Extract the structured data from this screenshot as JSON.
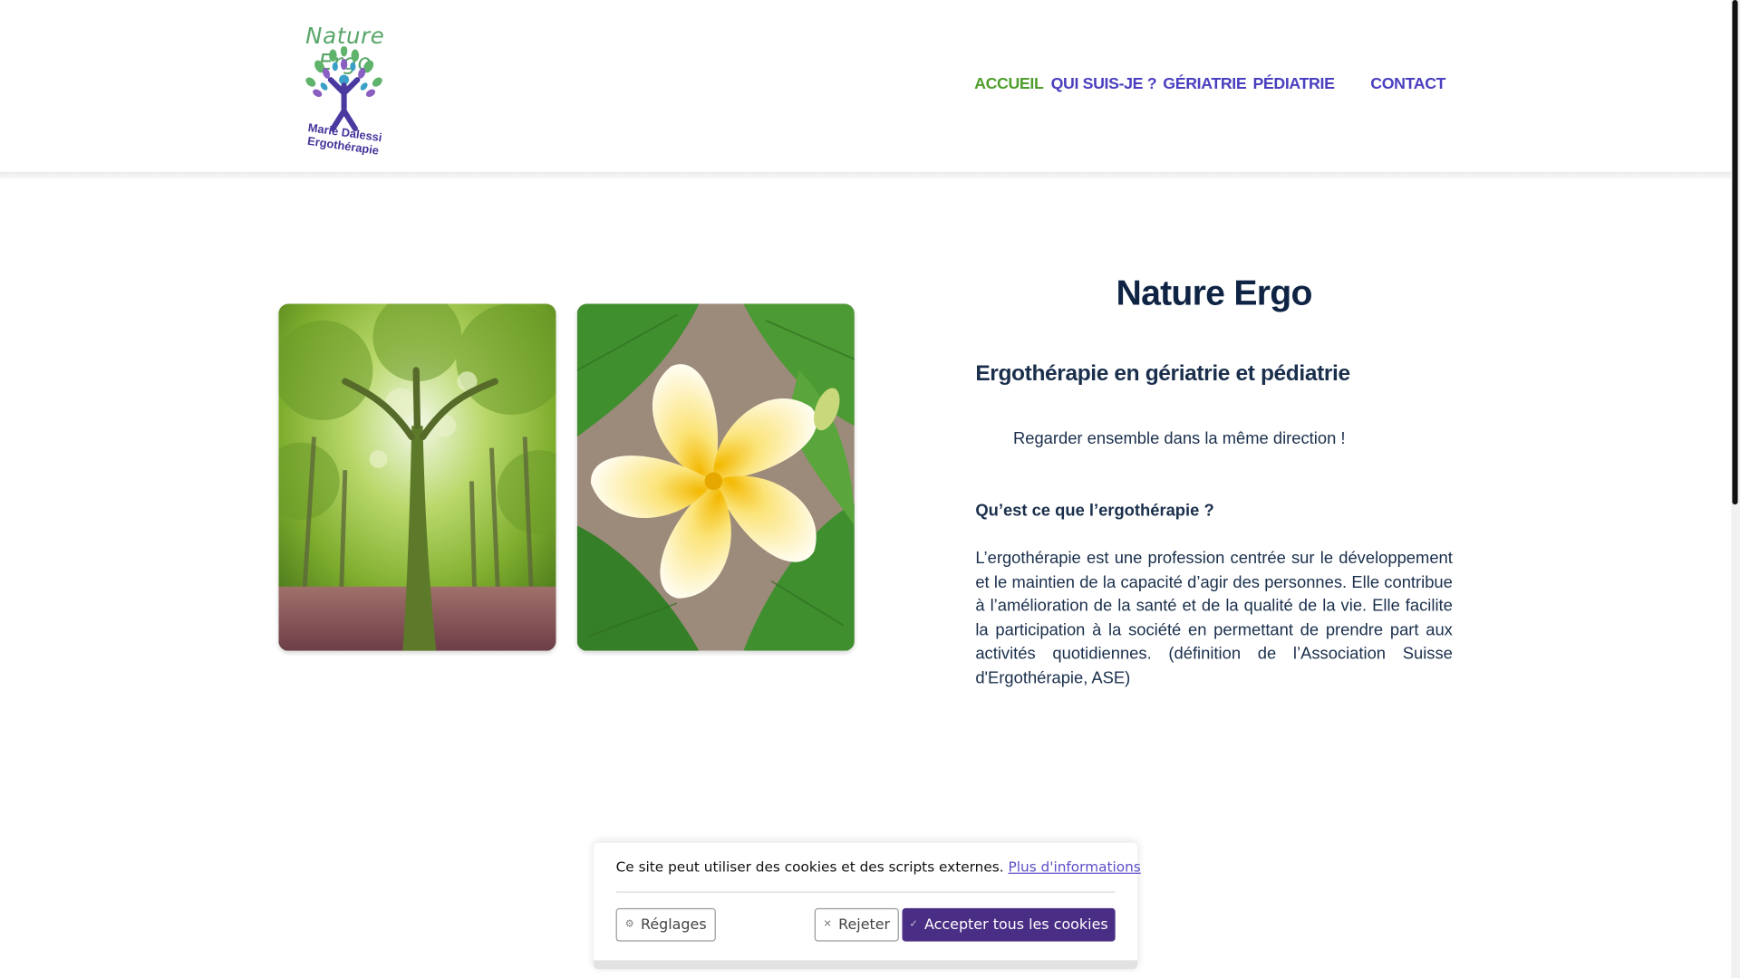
{
  "logo": {
    "title": "Nature Ergo",
    "subtitle": "Marie Dalessi Ergothérapie"
  },
  "nav": {
    "items": [
      {
        "label": "ACCUEIL",
        "active": true
      },
      {
        "label": "QUI SUIS-JE ?",
        "active": false
      },
      {
        "label": "GÉRIATRIE",
        "active": false
      },
      {
        "label": "PÉDIATRIE",
        "active": false
      },
      {
        "label": "CONTACT",
        "active": false
      }
    ]
  },
  "main": {
    "title": "Nature Ergo",
    "subtitle": "Ergothérapie en gériatrie et pédiatrie",
    "tagline": "Regarder ensemble dans la même direction !",
    "question": "Qu’est ce que l’ergothérapie ?",
    "paragraph": "L’ergothérapie est une profession centrée sur le développement et le maintien de la capacité d’agir des personnes. Elle contribue à l’amélioration de la santé et de la qualité de la vie. Elle facilite la participation à la société en permettant de prendre part aux activités quotidiennes. (définition de l’Association Suisse d'Ergothérapie, ASE)"
  },
  "cookie": {
    "message": "Ce site peut utiliser des cookies et des scripts externes.",
    "more_info": "Plus d'informations",
    "settings": "Réglages",
    "reject": "Rejeter",
    "accept": "Accepter tous les cookies"
  },
  "colors": {
    "nav_active": "#4f9e2d",
    "nav": "#4a3fbf",
    "heading": "#0f2444",
    "accept_button": "#4a2e85"
  }
}
